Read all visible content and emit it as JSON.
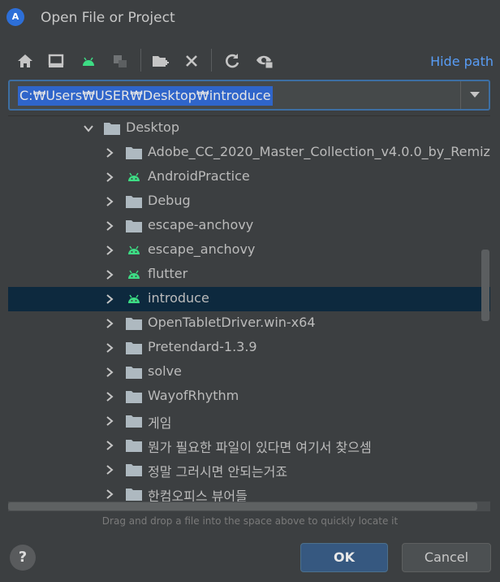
{
  "window": {
    "title": "Open File or Project",
    "logo_icon": "android-studio-logo"
  },
  "toolbar": {
    "icons": [
      "home-icon",
      "desktop-icon",
      "android-project-icon",
      "module-icon",
      "new-folder-icon",
      "delete-icon",
      "refresh-icon",
      "show-hidden-icon"
    ],
    "hide_path_label": "Hide path"
  },
  "path": {
    "value": "C:₩Users₩USER₩Desktop₩introduce"
  },
  "tree": {
    "root": {
      "label": "Desktop",
      "expanded": true
    },
    "items": [
      {
        "label": "Adobe_CC_2020_Master_Collection_v4.0.0_by_Remiz",
        "icon": "folder-icon"
      },
      {
        "label": "AndroidPractice",
        "icon": "android-icon"
      },
      {
        "label": "Debug",
        "icon": "folder-icon"
      },
      {
        "label": "escape-anchovy",
        "icon": "folder-icon"
      },
      {
        "label": "escape_anchovy",
        "icon": "android-icon"
      },
      {
        "label": "flutter",
        "icon": "android-icon"
      },
      {
        "label": "introduce",
        "icon": "android-icon",
        "selected": true
      },
      {
        "label": "OpenTabletDriver.win-x64",
        "icon": "folder-icon"
      },
      {
        "label": "Pretendard-1.3.9",
        "icon": "folder-icon"
      },
      {
        "label": "solve",
        "icon": "folder-icon"
      },
      {
        "label": "WayofRhythm",
        "icon": "folder-icon"
      },
      {
        "label": "게임",
        "icon": "folder-icon"
      },
      {
        "label": "뭔가 필요한 파일이 있다면 여기서 찾으셈",
        "icon": "folder-icon"
      },
      {
        "label": "정말 그러시면 안되는거죠",
        "icon": "folder-icon"
      },
      {
        "label": "한컴오피스 뷰어들",
        "icon": "folder-icon"
      }
    ]
  },
  "hint": "Drag and drop a file into the space above to quickly locate it",
  "buttons": {
    "help": "?",
    "ok": "OK",
    "cancel": "Cancel"
  },
  "colors": {
    "accent": "#589df6",
    "selection": "#0d293e",
    "android": "#3ddc84",
    "folder": "#aeb9c0"
  }
}
